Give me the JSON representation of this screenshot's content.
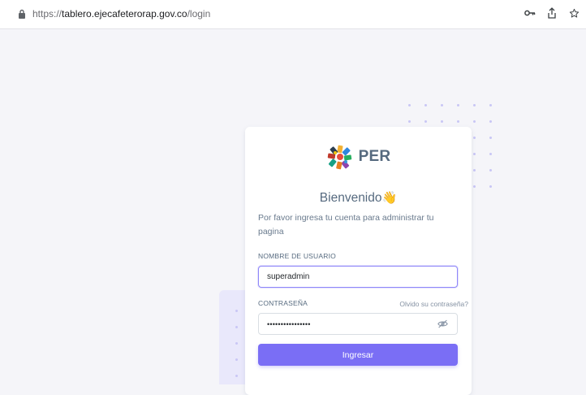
{
  "browser": {
    "url_scheme": "https://",
    "url_host": "tablero.ejecafeterorap.gov.co",
    "url_path": "/login",
    "icons": [
      "key-icon",
      "share-icon",
      "star-icon"
    ]
  },
  "login": {
    "brand": "PER",
    "title": "Bienvenido",
    "title_emoji": "👋",
    "subtitle": "Por favor ingresa tu cuenta para administrar tu pagina",
    "username_label": "NOMBRE DE USUARIO",
    "username_value": "superadmin",
    "password_label": "CONTRASEÑA",
    "forgot_label": "Olvido su contraseña?",
    "password_masked": "••••••••••••••••",
    "submit_label": "Ingresar"
  },
  "colors": {
    "accent": "#7a6ef5",
    "background": "#f5f5f9",
    "text": "#566a7f"
  }
}
